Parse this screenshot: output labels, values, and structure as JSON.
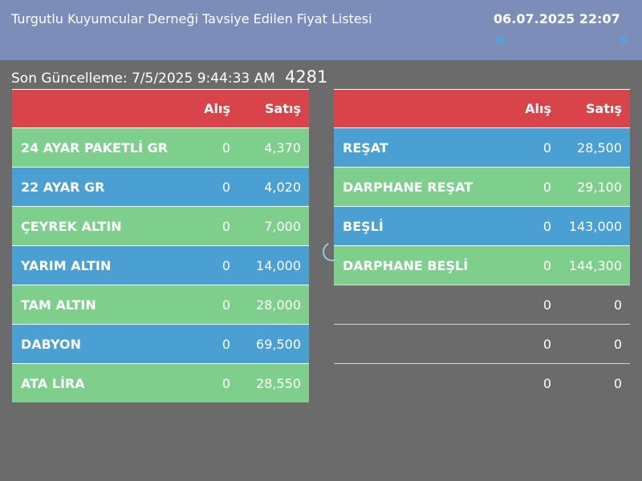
{
  "header": {
    "title": "Turgutlu Kuyumcular Derneği Tavsiye Edilen Fiyat Listesi",
    "clock": "06.07.2025 22:07",
    "icons": [
      "cloud-icon",
      "settings-icon"
    ]
  },
  "update": {
    "label": "Son Güncelleme: 7/5/2025 9:44:33 AM",
    "count": "4281"
  },
  "left_table": {
    "columns": [
      "Alış",
      "Satış"
    ],
    "rows": [
      {
        "name": "24 AYAR PAKETLİ GR",
        "buy": "0",
        "sell": "4,370",
        "color": "#7ecf8c"
      },
      {
        "name": "22 AYAR GR",
        "buy": "0",
        "sell": "4,020",
        "color": "#4aa0d2"
      },
      {
        "name": "ÇEYREK ALTIN",
        "buy": "0",
        "sell": "7,000",
        "color": "#7ecf8c"
      },
      {
        "name": "YARIM ALTIN",
        "buy": "0",
        "sell": "14,000",
        "color": "#4aa0d2"
      },
      {
        "name": "TAM ALTIN",
        "buy": "0",
        "sell": "28,000",
        "color": "#7ecf8c"
      },
      {
        "name": "DABYON",
        "buy": "0",
        "sell": "69,500",
        "color": "#4aa0d2"
      },
      {
        "name": "ATA LİRA",
        "buy": "0",
        "sell": "28,550",
        "color": "#7ecf8c"
      }
    ]
  },
  "right_table": {
    "columns": [
      "Alış",
      "Satış"
    ],
    "rows": [
      {
        "name": "REŞAT",
        "buy": "0",
        "sell": "28,500",
        "color": "#4aa0d2"
      },
      {
        "name": "DARPHANE REŞAT",
        "buy": "0",
        "sell": "29,100",
        "color": "#7ecf8c"
      },
      {
        "name": "BEŞLİ",
        "buy": "0",
        "sell": "143,000",
        "color": "#4aa0d2"
      },
      {
        "name": "DARPHANE BEŞLİ",
        "buy": "0",
        "sell": "144,300",
        "color": "#7ecf8c"
      },
      {
        "name": "",
        "buy": "0",
        "sell": "0",
        "color": ""
      },
      {
        "name": "",
        "buy": "0",
        "sell": "0",
        "color": ""
      },
      {
        "name": "",
        "buy": "0",
        "sell": "0",
        "color": ""
      }
    ]
  },
  "colors": {
    "header_bg": "#7b8db8",
    "page_bg": "#6b6b6b",
    "table_head": "#d9444a",
    "row_green": "#7ecf8c",
    "row_blue": "#4aa0d2"
  }
}
